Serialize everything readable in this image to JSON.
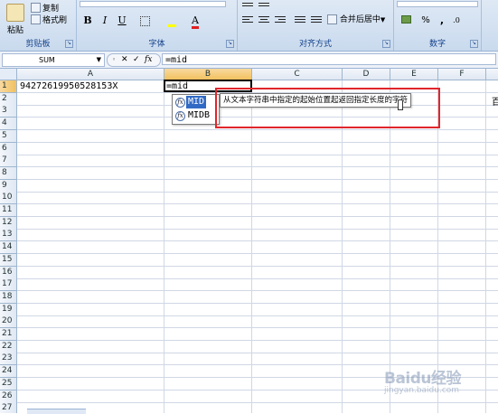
{
  "ribbon": {
    "clipboard": {
      "paste_label": "粘贴",
      "copy_label": "复制",
      "format_painter_label": "格式刷",
      "group_label": "剪贴板"
    },
    "font": {
      "bold": "B",
      "italic": "I",
      "underline": "U",
      "font_color_glyph": "A",
      "group_label": "字体"
    },
    "alignment": {
      "wrap_label": "合并后居中",
      "group_label": "对齐方式"
    },
    "number": {
      "percent": "%",
      "comma": ",",
      "group_label": "数字"
    }
  },
  "formula_bar": {
    "name_box": "SUM",
    "cancel_glyph": "✕",
    "enter_glyph": "✓",
    "fx_label": "fx",
    "formula": "=mid"
  },
  "grid": {
    "columns": [
      "A",
      "B",
      "C",
      "D",
      "E",
      "F"
    ],
    "selected_column": "B",
    "rows": [
      "1",
      "2",
      "3",
      "4",
      "5",
      "6",
      "7",
      "8",
      "9",
      "10",
      "11",
      "12",
      "13",
      "14",
      "15",
      "16",
      "17",
      "18",
      "19",
      "20",
      "21",
      "22",
      "23",
      "24",
      "25",
      "26",
      "27"
    ],
    "selected_row": "1",
    "cells": {
      "A1": "94272619950528153X",
      "B1": "=mid"
    }
  },
  "autocomplete": {
    "items": [
      {
        "label": "MID",
        "selected": true
      },
      {
        "label": "MIDB",
        "selected": false
      }
    ],
    "tooltip": "从文本字符串中指定的起始位置起返回指定长度的字符"
  },
  "overflow_glyph": "百",
  "watermark": {
    "text": "Baidu经验",
    "sub": "jingyan.baidu.com"
  },
  "colors": {
    "selection": "#316ac5",
    "highlight_box": "#e0262b",
    "header_selected": "#f1c15f"
  }
}
